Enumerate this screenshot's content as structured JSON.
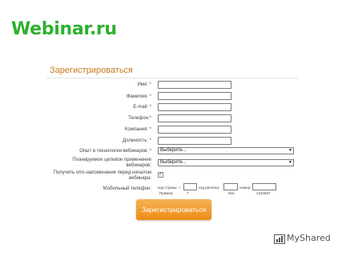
{
  "logo": "Webinar.ru",
  "form": {
    "title": "Зарегистрироваться",
    "fields": {
      "first_name": "Имя: *",
      "last_name": "Фамилия: *",
      "email": "E-mail: *",
      "phone": "Телефон:*",
      "company": "Компания: *",
      "position": "Должность: *"
    },
    "experience": {
      "label": "Опыт в технологии вебинаров: *",
      "value": "Выберите..."
    },
    "planned_use": {
      "label_line1": "Планируемое целевое применение",
      "label_line2": "вебинаров:",
      "value": "Выберите..."
    },
    "reminder": {
      "label_line1": "Получить sms-напоминание перед началом",
      "label_line2": "вебинара:",
      "checked": "✓"
    },
    "mobile": {
      "label": "Мобильный телефон:",
      "country_code_cap": "код страны: +",
      "region_code_cap": "код региона:",
      "number_cap": "номер:",
      "example_label": "Пример:",
      "example_country": "7",
      "example_region": "916",
      "example_number": "1234567"
    },
    "submit": "Зарегистрироваться"
  },
  "watermark": "MyShared"
}
